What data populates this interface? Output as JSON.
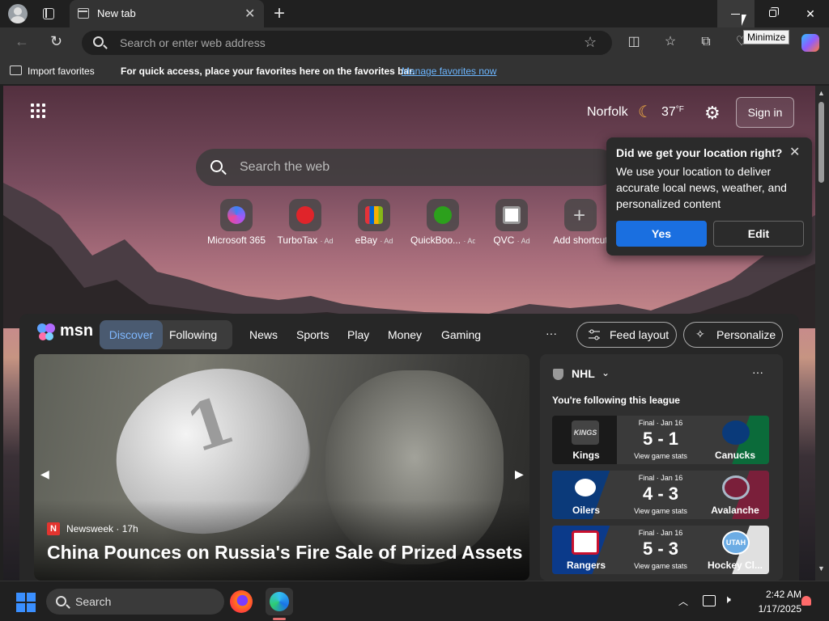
{
  "browser": {
    "tab": {
      "title": "New tab",
      "close": "✕"
    },
    "new_tab": "+",
    "window_controls": {
      "minimize_tooltip": "Minimize"
    },
    "address_bar": {
      "placeholder": "Search or enter web address"
    },
    "favorites_bar": {
      "import_label": "Import favorites",
      "message": "For quick access, place your favorites here on the favorites bar.",
      "manage_link": "Manage favorites now"
    },
    "icons": [
      "profile-icon",
      "tab-actions-icon",
      "back-icon",
      "refresh-icon",
      "search-icon",
      "star-icon",
      "split-screen-icon",
      "favorites-icon",
      "collections-icon",
      "copilot-icon"
    ]
  },
  "page": {
    "weather": {
      "city": "Norfolk",
      "temp": "37",
      "unit": "°F"
    },
    "sign_in": "Sign in",
    "search_placeholder": "Search the web",
    "shortcuts": [
      {
        "label": "Microsoft 365",
        "ad": ""
      },
      {
        "label": "TurboTax",
        "ad": "· Ad"
      },
      {
        "label": "eBay",
        "ad": "· Ad"
      },
      {
        "label": "QuickBoo...",
        "ad": "· Ad"
      },
      {
        "label": "QVC",
        "ad": "· Ad"
      },
      {
        "label": "Add shortcut",
        "ad": ""
      }
    ],
    "location_popup": {
      "title": "Did we get your location right?",
      "body": "We use your location to deliver accurate local news, weather, and personalized content",
      "yes": "Yes",
      "edit": "Edit"
    },
    "feed": {
      "brand": "msn",
      "toggle": {
        "discover": "Discover",
        "following": "Following"
      },
      "nav": [
        "News",
        "Sports",
        "Play",
        "Money",
        "Gaming"
      ],
      "more": "···",
      "feed_layout": "Feed layout",
      "personalize": "Personalize",
      "hero": {
        "source": "Newsweek",
        "source_initial": "N",
        "age": "· 17h",
        "headline": "China Pounces on Russia's Fire Sale of Prized Assets",
        "coin_digit": "1"
      },
      "nhl": {
        "title": "NHL",
        "more": "···",
        "subtitle": "You're following this league",
        "games": [
          {
            "status": "Final · Jan 16",
            "score": "5 - 1",
            "stats": "View game stats",
            "home": "Kings",
            "home_logo": "KINGS",
            "away": "Canucks",
            "home_color": "#1a1a1a",
            "away_color": "#0b6b3a"
          },
          {
            "status": "Final · Jan 16",
            "score": "4 - 3",
            "stats": "View game stats",
            "home": "Oilers",
            "home_logo": "",
            "away": "Avalanche",
            "home_color": "#0b3a7a",
            "away_color": "#7a1f3a"
          },
          {
            "status": "Final · Jan 16",
            "score": "5 - 3",
            "stats": "View game stats",
            "home": "Rangers",
            "home_logo": "",
            "away": "Hockey Cl...",
            "away_logo": "UTAH",
            "home_color": "#0b3a8a",
            "away_color": "#d8d8d8"
          }
        ]
      }
    }
  },
  "taskbar": {
    "search": "Search",
    "time": "2:42 AM",
    "date": "1/17/2025"
  }
}
